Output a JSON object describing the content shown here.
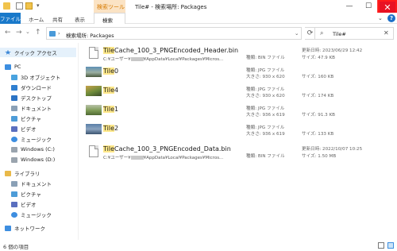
{
  "titlebar": {
    "search_tools_label": "検索ツール",
    "title": "Tile# - 検索場所: Packages",
    "minimize": "—",
    "maximize": "☐",
    "close": "✕"
  },
  "ribbon": {
    "tabs": [
      {
        "label": "ファイル"
      },
      {
        "label": "ホーム"
      },
      {
        "label": "共有"
      },
      {
        "label": "表示"
      },
      {
        "label": "検索"
      }
    ],
    "chevron": "⌄",
    "help": "?"
  },
  "address": {
    "back": "←",
    "forward": "→",
    "recent": "⌄",
    "up": "↑",
    "path_chevron": "›",
    "path": "検索場所: Packages",
    "dropdown": "⌄",
    "refresh": "⟳",
    "search_value": "Tile#",
    "search_clear": "✕"
  },
  "nav": {
    "quick_access": "クイック アクセス",
    "pc": "PC",
    "pc_items": [
      "3D オブジェクト",
      "ダウンロード",
      "デスクトップ",
      "ドキュメント",
      "ピクチャ",
      "ビデオ",
      "ミュージック",
      "Windows (C:)",
      "Windows (D:)"
    ],
    "library": "ライブラリ",
    "library_items": [
      "ドキュメント",
      "ピクチャ",
      "ビデオ",
      "ミュージック"
    ],
    "network": "ネットワーク"
  },
  "files": [
    {
      "name_hl": "Tile",
      "name_rest": "Cache_100_3_PNGEncoded_Header.bin",
      "path_prefix": "C:¥ユーザー¥",
      "path_suffix": "¥AppData¥Local¥Packages¥Micros...",
      "meta1": "種類: BIN ファイル",
      "meta1b": "",
      "date": "更新日時: 2023/06/29 12:42",
      "size": "サイズ: 47.9 KB",
      "kind": "doc"
    },
    {
      "name_hl": "Tile",
      "name_rest": "0",
      "meta1": "種類: JPG ファイル",
      "meta1b": "大きさ: 930 x 620",
      "size": "サイズ: 160 KB",
      "kind": "img",
      "colors": [
        "#5d8fb5",
        "#9cb0a2",
        "#4a5a3e"
      ]
    },
    {
      "name_hl": "Tile",
      "name_rest": "4",
      "meta1": "種類: JPG ファイル",
      "meta1b": "大きさ: 930 x 620",
      "size": "サイズ: 174 KB",
      "kind": "img",
      "colors": [
        "#c7a24a",
        "#6d8b3a",
        "#3a4a2a"
      ]
    },
    {
      "name_hl": "Tile",
      "name_rest": "1",
      "meta1": "種類: JPG ファイル",
      "meta1b": "大きさ: 936 x 619",
      "size": "サイズ: 91.3 KB",
      "kind": "img",
      "colors": [
        "#b8c2a8",
        "#7d9a55",
        "#4f6a34"
      ]
    },
    {
      "name_hl": "Tile",
      "name_rest": "2",
      "meta1": "種類: JPG ファイル",
      "meta1b": "大きさ: 936 x 619",
      "size": "サイズ: 133 KB",
      "kind": "img",
      "colors": [
        "#5a7fa8",
        "#8ba4c0",
        "#3c5470"
      ]
    },
    {
      "name_hl": "Tile",
      "name_rest": "Cache_100_3_PNGEncoded_Data.bin",
      "path_prefix": "C:¥ユーザー¥",
      "path_suffix": "¥AppData¥Local¥Packages¥Micros...",
      "meta1": "種類: BIN ファイル",
      "meta1b": "",
      "date": "更新日時: 2022/10/07 10:25",
      "size": "サイズ: 1.50 MB",
      "kind": "doc"
    }
  ],
  "status": {
    "count": "6 個の項目"
  }
}
